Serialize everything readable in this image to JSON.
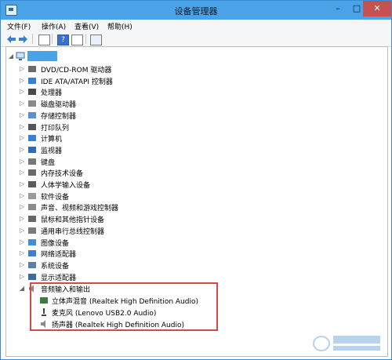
{
  "window": {
    "title": "设备管理器",
    "controls": {
      "minimize": "–",
      "maximize": "□",
      "close": "✕"
    }
  },
  "menu": {
    "file": "文件(F)",
    "action": "操作(A)",
    "view": "查看(V)",
    "help": "帮助(H)"
  },
  "toolbar": {
    "back_icon": "arrow-left-icon",
    "forward_icon": "arrow-right-icon",
    "help_label": "?"
  },
  "tree": {
    "root_icon": "computer-icon",
    "items": [
      {
        "label": "DVD/CD-ROM 驱动器",
        "icon": "dvd-drive-icon"
      },
      {
        "label": "IDE ATA/ATAPI 控制器",
        "icon": "ide-controller-icon"
      },
      {
        "label": "处理器",
        "icon": "processor-icon"
      },
      {
        "label": "磁盘驱动器",
        "icon": "disk-drive-icon"
      },
      {
        "label": "存储控制器",
        "icon": "storage-controller-icon"
      },
      {
        "label": "打印队列",
        "icon": "printer-icon"
      },
      {
        "label": "计算机",
        "icon": "computer-icon"
      },
      {
        "label": "监视器",
        "icon": "monitor-icon"
      },
      {
        "label": "键盘",
        "icon": "keyboard-icon"
      },
      {
        "label": "内存技术设备",
        "icon": "memory-icon"
      },
      {
        "label": "人体学输入设备",
        "icon": "hid-icon"
      },
      {
        "label": "软件设备",
        "icon": "software-device-icon"
      },
      {
        "label": "声音、视频和游戏控制器",
        "icon": "speaker-icon"
      },
      {
        "label": "鼠标和其他指针设备",
        "icon": "mouse-icon"
      },
      {
        "label": "通用串行总线控制器",
        "icon": "usb-icon"
      },
      {
        "label": "图像设备",
        "icon": "camera-icon"
      },
      {
        "label": "网络适配器",
        "icon": "network-icon"
      },
      {
        "label": "系统设备",
        "icon": "system-device-icon"
      },
      {
        "label": "显示适配器",
        "icon": "display-adapter-icon"
      }
    ],
    "expanded": {
      "label": "音频输入和输出",
      "icon": "audio-io-icon",
      "children": [
        {
          "label": "立体声混音 (Realtek High Definition Audio)",
          "icon": "stereo-mix-icon"
        },
        {
          "label": "麦克风 (Lenovo USB2.0 Audio)",
          "icon": "microphone-icon"
        },
        {
          "label": "扬声器 (Realtek High Definition Audio)",
          "icon": "speaker-icon"
        }
      ]
    }
  },
  "colors": {
    "titlebar": "#4aa3e6",
    "close_button": "#c75050",
    "highlight_border": "#d24a4a"
  }
}
